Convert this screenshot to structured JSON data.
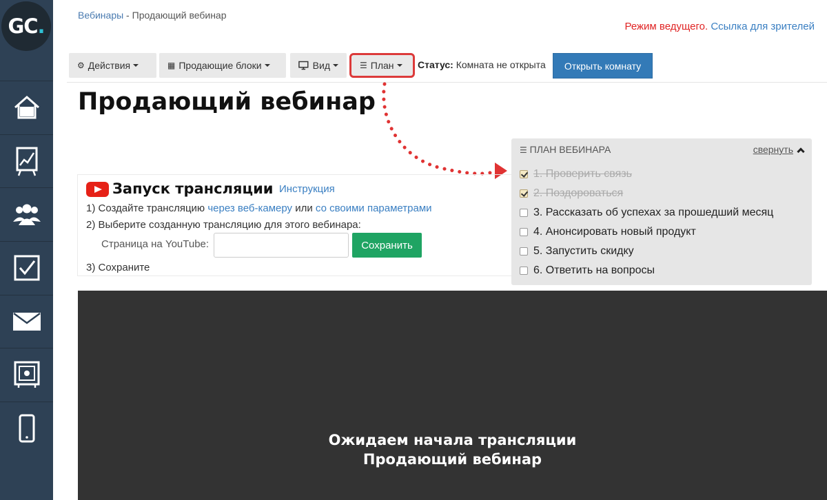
{
  "sidebar": {
    "logo": {
      "g": "GC",
      "dot": "."
    },
    "items": [
      {
        "icon": "home-icon"
      },
      {
        "icon": "chart-board-icon"
      },
      {
        "icon": "users-icon"
      },
      {
        "icon": "checkbox-icon"
      },
      {
        "icon": "mail-icon"
      },
      {
        "icon": "safe-icon"
      },
      {
        "icon": "mobile-icon"
      }
    ]
  },
  "breadcrumb": {
    "parent": "Вебинары",
    "separator": " - ",
    "current": "Продающий вебинар"
  },
  "topright": {
    "host_mode": "Режим ведущего.",
    "viewers_link": "Ссылка для зрителей"
  },
  "toolbar": {
    "actions": "Действия",
    "selling_blocks": "Продающие блоки",
    "view": "Вид",
    "plan": "План",
    "status_label": "Статус:",
    "status_value": "Комната не открыта",
    "open_room": "Открыть комнату"
  },
  "page_title": "Продающий вебинар",
  "broadcast": {
    "title": "Запуск трансляции",
    "instruction": "Инструкция",
    "step1_prefix": "1) Создайте трансляцию ",
    "step1_link1": "через веб-камеру",
    "step1_mid": " или ",
    "step1_link2": "со своими параметрами",
    "step2": "2) Выберите созданную трансляцию для этого вебинара:",
    "youtube_label": "Страница на YouTube:",
    "youtube_value": "",
    "save": "Сохранить",
    "step3": "3) Сохраните"
  },
  "plan": {
    "title": "ПЛАН ВЕБИНАРА",
    "collapse": "свернуть",
    "items": [
      {
        "label": "1. Проверить связь",
        "checked": true
      },
      {
        "label": "2. Поздороваться",
        "checked": true
      },
      {
        "label": "3. Рассказать об успехах за прошедший месяц",
        "checked": false
      },
      {
        "label": "4. Анонсировать новый продукт",
        "checked": false
      },
      {
        "label": "5. Запустить скидку",
        "checked": false
      },
      {
        "label": "6. Ответить на вопросы",
        "checked": false
      }
    ]
  },
  "video": {
    "line1": "Ожидаем начала трансляции",
    "line2": "Продающий вебинар"
  },
  "colors": {
    "sidebar": "#2e4155",
    "accent_blue": "#337ab7",
    "save_green": "#1fa463",
    "highlight_red": "#dc3a3a",
    "video_bg": "#333333"
  }
}
